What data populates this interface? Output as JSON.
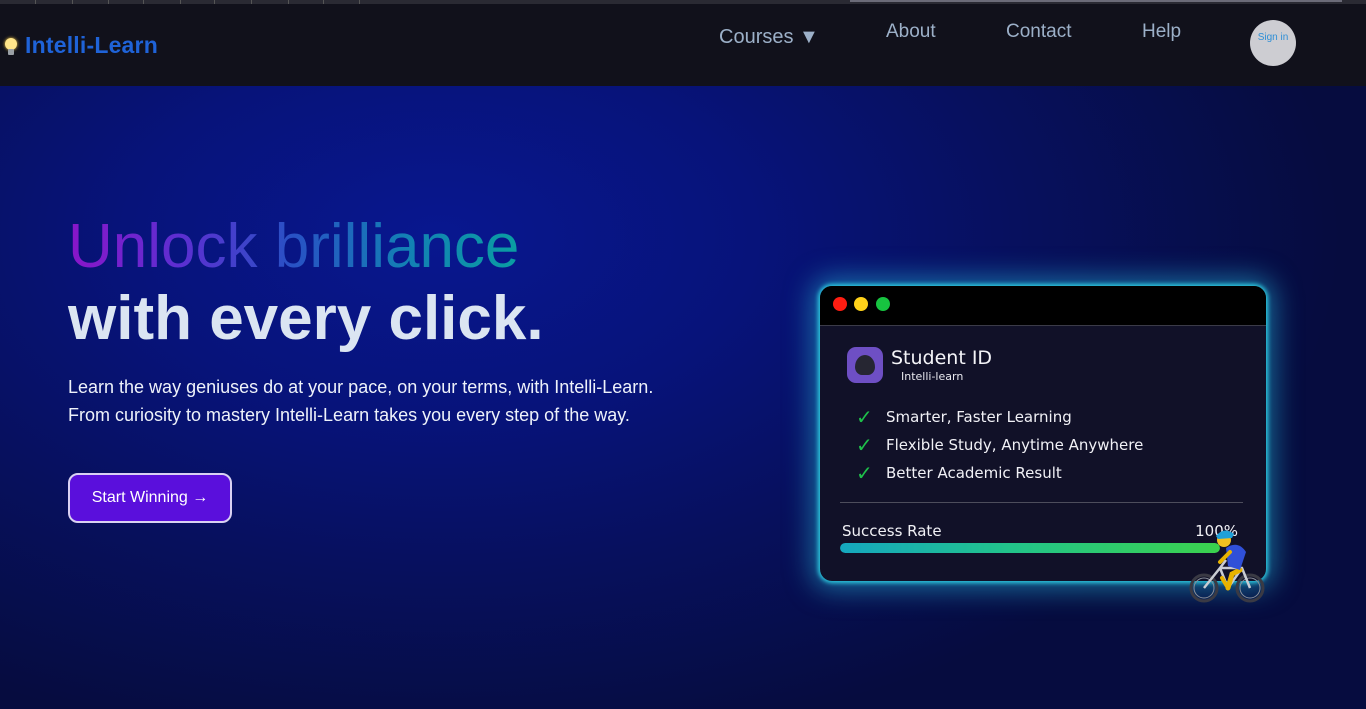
{
  "brand": {
    "name": "Intelli-Learn",
    "icon": "lightbulb-icon"
  },
  "nav": {
    "courses": "Courses ▼",
    "about": "About",
    "contact": "Contact",
    "help": "Help",
    "signin": "Sign in"
  },
  "hero": {
    "headline_gradient": "Unlock brilliance",
    "headline_plain": "with every click.",
    "lede_line1": "Learn the way geniuses do at your pace, on your terms, with Intelli-Learn.",
    "lede_line2": "From curiosity to mastery Intelli-Learn takes you every step of the way.",
    "cta": "Start Winning →"
  },
  "card": {
    "title": "Student ID",
    "subtitle": "Intelli-learn",
    "features": [
      "Smarter, Faster Learning",
      "Flexible Study, Anytime Anywhere",
      "Better Academic Result"
    ],
    "rate_label": "Success Rate",
    "rate_value": "100%",
    "rate_percent": 100
  },
  "colors": {
    "accent": "#5a0fdc",
    "brand_blue": "#1f63d8",
    "glow": "#2cc9df",
    "check": "#1ec04a"
  }
}
